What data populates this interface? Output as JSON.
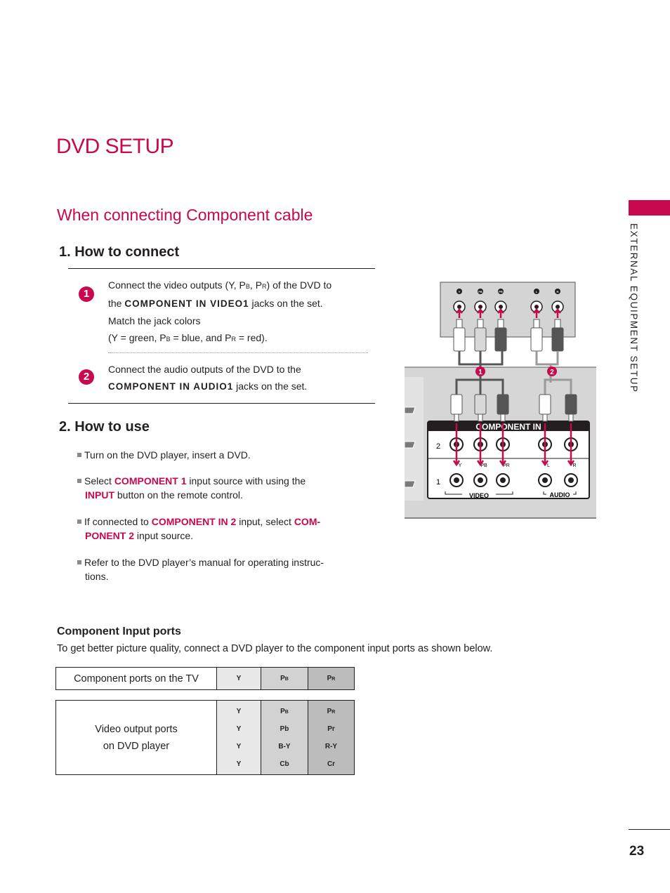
{
  "page": {
    "title": "DVD SETUP",
    "section_title": "When connecting Component cable",
    "side_label": "EXTERNAL EQUIPMENT SETUP",
    "page_number": "23",
    "accent_color": "#c8084f"
  },
  "how_to_connect": {
    "heading": "1. How to connect",
    "steps": [
      {
        "badge": "1",
        "line1_a": "Connect the video outputs (",
        "y": "Y",
        "sep1": ", P",
        "b_sub": "B",
        "sep2": ", P",
        "r_sub": "R",
        "line1_b": ") of the DVD  to",
        "line2_a": "the ",
        "line2_kw": "COMPONENT IN VIDEO1",
        "line2_b": " jacks on the set.",
        "line3": "Match the jack colors",
        "line4_a": "(",
        "line4_y": "Y",
        "line4_b": " = green, P",
        "line4_bsub": "B",
        "line4_c": " = blue, and P",
        "line4_rsub": "R",
        "line4_d": " = red)."
      },
      {
        "badge": "2",
        "line1": "Connect the audio outputs of the DVD to the",
        "line2_kw": "COMPONENT IN AUDIO1",
        "line2_b": " jacks on the set."
      }
    ]
  },
  "how_to_use": {
    "heading": "2. How to use",
    "bullets": [
      {
        "text": "Turn on the DVD player, insert a DVD."
      },
      {
        "a": "Select ",
        "kw1": "COMPONENT 1",
        "b": " input source with using the",
        "kw2": "INPUT",
        "c": " button on the remote control."
      },
      {
        "a": "If connected to ",
        "kw1": "COMPONENT IN 2",
        "b": " input, select ",
        "kw2a": "COM-",
        "kw2b": "PONENT 2",
        "c": " input source."
      },
      {
        "a": "Refer to the DVD player’s manual for operating instruc-",
        "b": "tions."
      }
    ]
  },
  "diagram": {
    "dvd_jacks": [
      "Y",
      "PB",
      "PR",
      "L",
      "R"
    ],
    "callouts": [
      "1",
      "2"
    ],
    "panel_title": "COMPONENT IN",
    "row_labels": [
      "2",
      "1"
    ],
    "jack_labels": [
      "Y",
      "PB",
      "PR",
      "L",
      "R"
    ],
    "group_labels": [
      "VIDEO",
      "AUDIO"
    ]
  },
  "component_ports": {
    "heading": "Component Input ports",
    "description": "To get better picture quality, connect a DVD player to the component input ports as shown below.",
    "tv_row": {
      "label": "Component ports on the TV",
      "cols": [
        {
          "main": "Y",
          "sub": ""
        },
        {
          "main": "P",
          "sub": "B"
        },
        {
          "main": "P",
          "sub": "R"
        }
      ]
    },
    "dvd_row": {
      "label_line1": "Video output ports",
      "label_line2": "on DVD player",
      "col_y": [
        "Y",
        "Y",
        "Y",
        "Y"
      ],
      "col_b": [
        {
          "main": "P",
          "sub": "B"
        },
        {
          "main": "Pb"
        },
        {
          "main": "B-Y"
        },
        {
          "main": "Cb"
        }
      ],
      "col_r": [
        {
          "main": "P",
          "sub": "R"
        },
        {
          "main": "Pr"
        },
        {
          "main": "R-Y"
        },
        {
          "main": "Cr"
        }
      ]
    }
  }
}
